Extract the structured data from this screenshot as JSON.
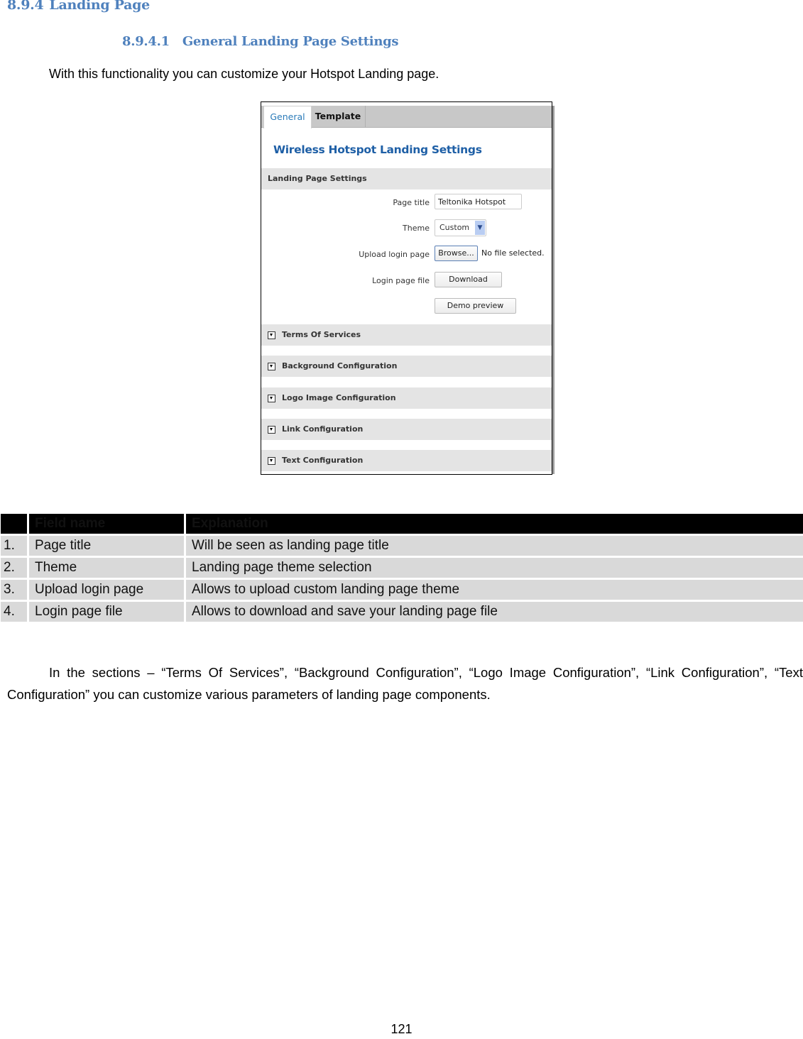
{
  "heading": {
    "number": "8.9.4",
    "title": "Landing Page"
  },
  "subheading": {
    "number": "8.9.4.1",
    "title": "General Landing Page Settings"
  },
  "intro": "With this functionality you can customize your Hotspot Landing page.",
  "screenshot": {
    "tabs": [
      {
        "label": "General",
        "active": true
      },
      {
        "label": "Template",
        "active": false
      }
    ],
    "title": "Wireless Hotspot Landing Settings",
    "section_label": "Landing Page Settings",
    "fields": {
      "page_title": {
        "label": "Page title",
        "value": "Teltonika Hotspot"
      },
      "theme": {
        "label": "Theme",
        "value": "Custom"
      },
      "upload": {
        "label": "Upload login page",
        "button": "Browse...",
        "status": "No file selected."
      },
      "login_file": {
        "label": "Login page file",
        "button": "Download"
      },
      "demo_button": "Demo preview"
    },
    "collapsible_sections": [
      "Terms Of Services",
      "Background Configuration",
      "Logo Image Configuration",
      "Link Configuration",
      "Text Configuration"
    ]
  },
  "table": {
    "headers": [
      "",
      "Field name",
      "Explanation"
    ],
    "rows": [
      [
        "1.",
        "Page title",
        "Will be seen as landing page title"
      ],
      [
        "2.",
        "Theme",
        "Landing page theme selection"
      ],
      [
        "3.",
        "Upload login page",
        "Allows to upload custom landing page theme"
      ],
      [
        "4.",
        "Login page file",
        "Allows to download and save your landing page file"
      ]
    ]
  },
  "paragraph": "In the sections – “Terms Of Services”, “Background Configuration”, “Logo Image Configuration”, “Link Configuration”, “Text Configuration” you can customize various parameters of landing page components.",
  "page_number": "121"
}
